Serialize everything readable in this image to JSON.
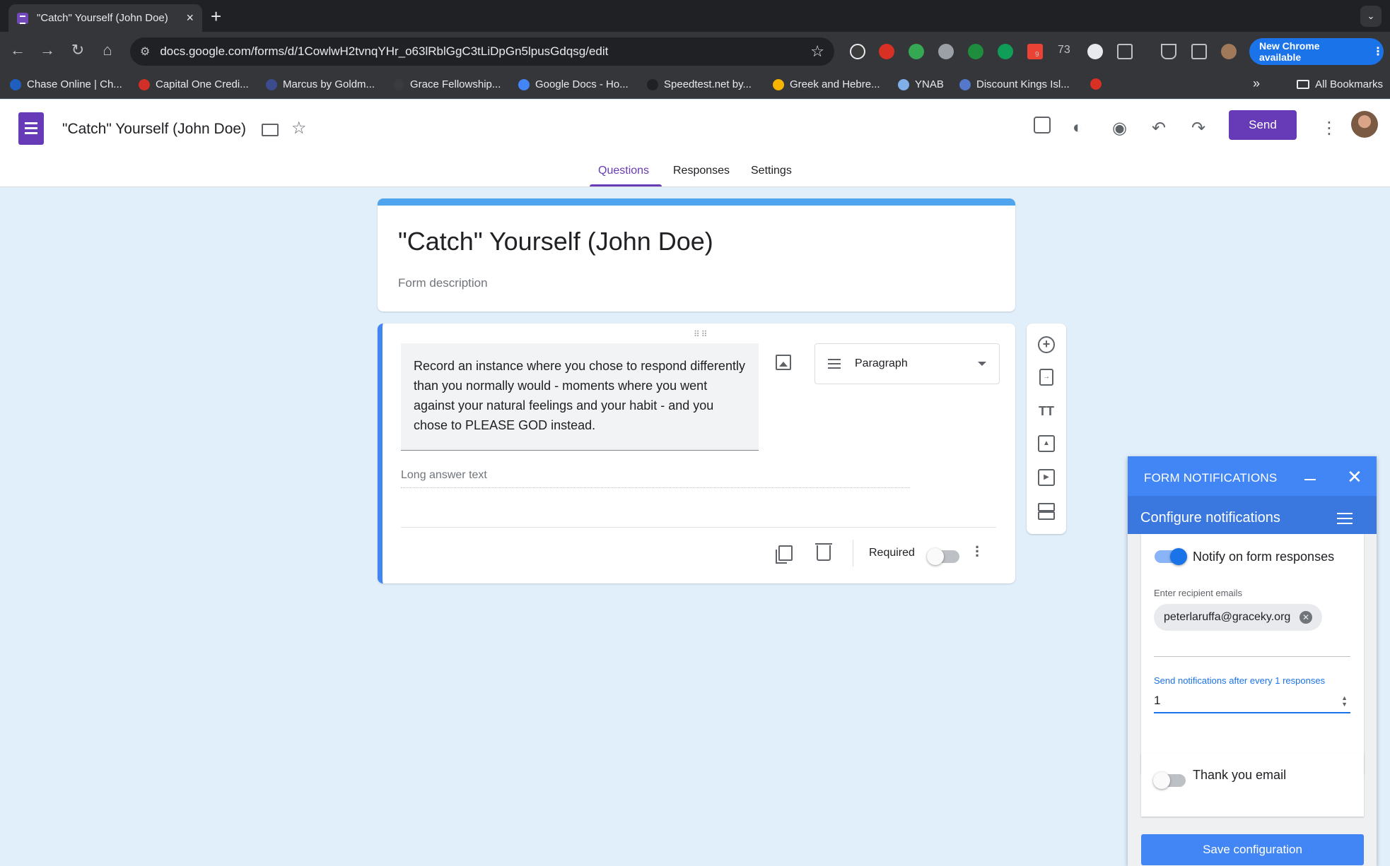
{
  "browser": {
    "tab_title": "\"Catch\" Yourself (John Doe)",
    "tab_close": "×",
    "new_tab": "+",
    "url": "docs.google.com/forms/d/1CowlwH2tvnqYHr_o63lRblGgC3tLiDpGn5lpusGdqsg/edit",
    "extension_badge": "73",
    "extension_count": "9",
    "chrome_update": "New Chrome available",
    "bookmarks": [
      {
        "label": "Chase Online | Ch...",
        "color": "#1f5fbf"
      },
      {
        "label": "Capital One Credi...",
        "color": "#d03027"
      },
      {
        "label": "Marcus by Goldm...",
        "color": "#3c4c8c"
      },
      {
        "label": "Grace Fellowship...",
        "color": "#3a3b3f"
      },
      {
        "label": "Google Docs - Ho...",
        "color": "#4285f4"
      },
      {
        "label": "Speedtest.net by...",
        "color": "#202124"
      },
      {
        "label": "Greek and Hebre...",
        "color": "#f4b400"
      },
      {
        "label": "YNAB",
        "color": "#7fb0e8"
      },
      {
        "label": "Discount Kings Isl...",
        "color": "#5577cc"
      }
    ],
    "bookmarks_more": "»",
    "all_bookmarks": "All Bookmarks"
  },
  "header": {
    "doc_title": "\"Catch\" Yourself (John Doe)",
    "send_label": "Send",
    "tabs": [
      {
        "label": "Questions",
        "active": true
      },
      {
        "label": "Responses",
        "active": false
      },
      {
        "label": "Settings",
        "active": false
      }
    ]
  },
  "form": {
    "title": "\"Catch\" Yourself (John Doe)",
    "description_placeholder": "Form description",
    "question": {
      "text": "Record an instance where you chose to respond differently than you normally would - moments where you went against your natural feelings and your habit - and you chose to PLEASE GOD instead.",
      "type": "Paragraph",
      "answer_placeholder": "Long answer text",
      "required_label": "Required",
      "required": false
    }
  },
  "notifications": {
    "header_title": "FORM NOTIFICATIONS",
    "close": "✕",
    "sub_title": "Configure notifications",
    "notify_label": "Notify on form responses",
    "notify_on": true,
    "recipient_label": "Enter recipient emails",
    "recipient_email": "peterlaruffa@graceky.org",
    "chip_remove": "✕",
    "every_label": "Send notifications after every 1 responses",
    "every_value": "1",
    "thank_you_label": "Thank you email",
    "thank_you_on": false,
    "save_label": "Save configuration"
  },
  "icons": {
    "back": "←",
    "forward": "→",
    "reload": "↻",
    "home": "⌂",
    "star": "☆",
    "folder": "🗀",
    "palette": "◐",
    "preview": "◉",
    "undo": "↶",
    "redo": "↷",
    "more": "⋮",
    "add": "+",
    "title_tt": "TT",
    "video": "▶"
  }
}
